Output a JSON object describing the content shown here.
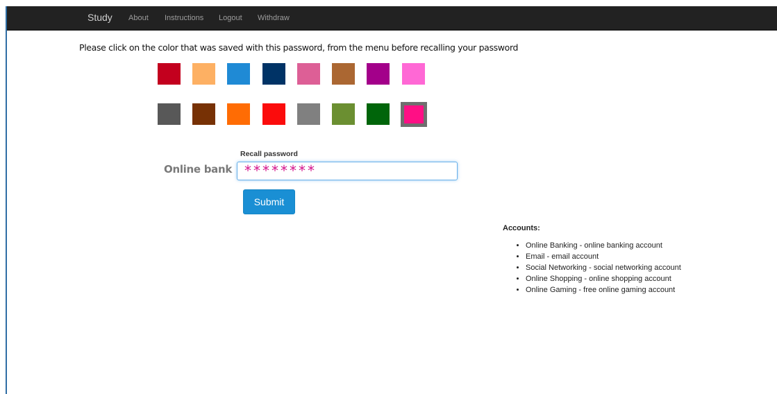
{
  "nav": {
    "brand": "Study",
    "links": [
      "About",
      "Instructions",
      "Logout",
      "Withdraw"
    ]
  },
  "prompt": "Please click on the color that was saved with this password, from the menu before recalling your password",
  "colors": {
    "row1": [
      "#c3001e",
      "#fdb063",
      "#1f8ad5",
      "#003366",
      "#dd5f96",
      "#ab6732",
      "#a3008a",
      "#ff68d5"
    ],
    "row2": [
      "#585858",
      "#773105",
      "#ff6c04",
      "#fb0c0c",
      "#808080",
      "#6b8f31",
      "#00650a",
      "#ff0f85"
    ],
    "selected": "#ff0f85"
  },
  "form": {
    "site_label": "Online bank",
    "recall_label": "Recall password",
    "password_value": "********",
    "submit_label": "Submit"
  },
  "accounts": {
    "title": "Accounts:",
    "items": [
      "Online Banking - online banking account",
      "Email - email account",
      "Social Networking - social networking account",
      "Online Shopping - online shopping account",
      "Online Gaming - free online gaming account"
    ]
  }
}
